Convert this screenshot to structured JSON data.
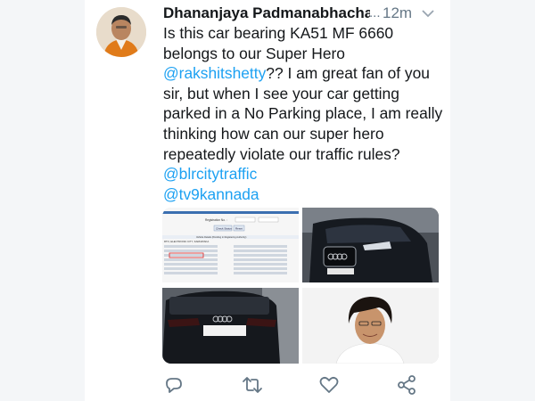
{
  "tweet": {
    "author_name": "Dhananjaya Padmanabhachar",
    "more_glyph": "...",
    "time": "12m",
    "text_lines": [
      "Is this car bearing KA51 MF 6660",
      "belongs to our Super Hero",
      "@rakshitshetty?? I am great fan of you",
      "sir, but when I see your car getting",
      "parked in a No Parking place, I am really",
      "thinking how can our super hero",
      "repeatedly violate our traffic rules?",
      "@blrcitytraffic",
      "@tv9kannada"
    ],
    "mentions": [
      "@rakshitshetty",
      "@blrcitytraffic",
      "@tv9kannada"
    ],
    "reg_form": {
      "field_label": "Registration No. :",
      "check_label": "Check Status",
      "reset_label": "Reset",
      "section_title": "Vehicle Details (Pending in Registering Authority)",
      "authority": "RTO, ELECTRONIC CITY, KARNATAKA"
    }
  },
  "colors": {
    "link": "#1da1f2",
    "text": "#14171a",
    "muted": "#657786",
    "frame": "#f4f6f8"
  },
  "icons": {
    "reply": "reply-icon",
    "retweet": "retweet-icon",
    "like": "heart-icon",
    "share": "share-icon",
    "menu": "chevron-down-icon"
  }
}
